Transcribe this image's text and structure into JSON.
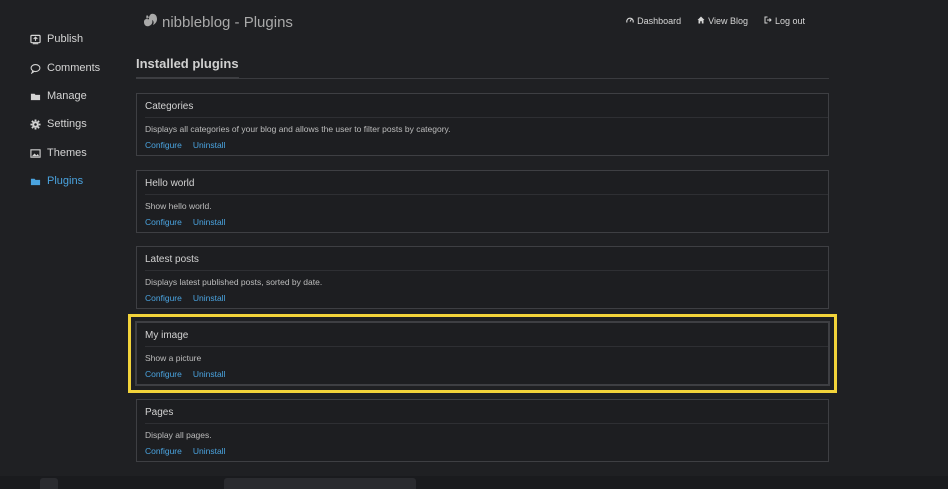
{
  "sidebar": {
    "items": [
      {
        "label": "Publish",
        "icon": "publish-icon",
        "active": false
      },
      {
        "label": "Comments",
        "icon": "comment-icon",
        "active": false
      },
      {
        "label": "Manage",
        "icon": "folder-icon",
        "active": false
      },
      {
        "label": "Settings",
        "icon": "gear-icon",
        "active": false
      },
      {
        "label": "Themes",
        "icon": "image-icon",
        "active": false
      },
      {
        "label": "Plugins",
        "icon": "folder-icon",
        "active": true
      }
    ]
  },
  "header": {
    "title": "nibbleblog - Plugins",
    "links": [
      {
        "label": "Dashboard",
        "icon": "dashboard-icon"
      },
      {
        "label": "View Blog",
        "icon": "home-icon"
      },
      {
        "label": "Log out",
        "icon": "logout-icon"
      }
    ]
  },
  "main": {
    "section_title": "Installed plugins",
    "plugins": [
      {
        "name": "Categories",
        "description": "Displays all categories of your blog and allows the user to filter posts by category.",
        "configure": "Configure",
        "uninstall": "Uninstall"
      },
      {
        "name": "Hello world",
        "description": "Show hello world.",
        "configure": "Configure",
        "uninstall": "Uninstall"
      },
      {
        "name": "Latest posts",
        "description": "Displays latest published posts, sorted by date.",
        "configure": "Configure",
        "uninstall": "Uninstall"
      },
      {
        "name": "My image",
        "description": "Show a picture",
        "configure": "Configure",
        "uninstall": "Uninstall"
      },
      {
        "name": "Pages",
        "description": "Display all pages.",
        "configure": "Configure",
        "uninstall": "Uninstall"
      }
    ]
  },
  "colors": {
    "background": "#1f2023",
    "accent": "#4aa3df",
    "highlight": "#f2d33a"
  }
}
